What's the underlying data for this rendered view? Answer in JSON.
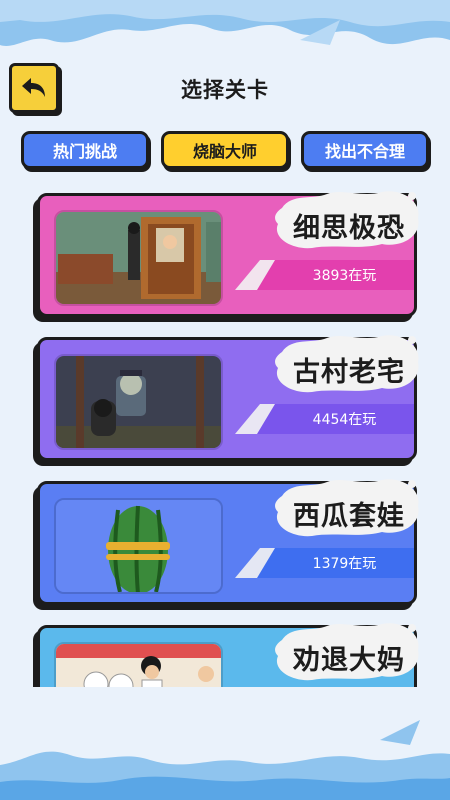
{
  "header": {
    "title": "选择关卡",
    "back_icon": "back-arrow-icon"
  },
  "tabs": [
    {
      "label": "热门挑战",
      "active": false
    },
    {
      "label": "烧脑大师",
      "active": true
    },
    {
      "label": "找出不合理",
      "active": false
    }
  ],
  "levels": [
    {
      "name": "细思极恐",
      "players": "3893在玩",
      "color": "#e85fbd",
      "stripe": "#e33fae"
    },
    {
      "name": "古村老宅",
      "players": "4454在玩",
      "color": "#8f6df0",
      "stripe": "#7a55ec"
    },
    {
      "name": "西瓜套娃",
      "players": "1379在玩",
      "color": "#5a7ef3",
      "stripe": "#3e6ef0"
    },
    {
      "name": "劝退大妈",
      "players": "",
      "color": "#5bb9ec",
      "stripe": "#3aa8e8"
    }
  ],
  "colors": {
    "accent_yellow": "#ffcf2e",
    "tab_blue": "#4d7df2",
    "background": "#eaf2fb"
  }
}
